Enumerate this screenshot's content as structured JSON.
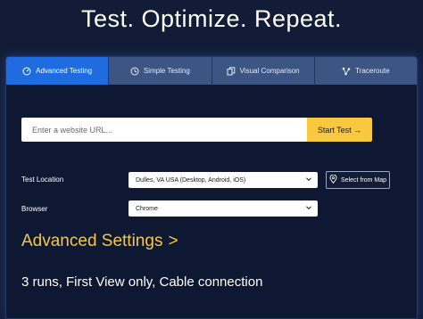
{
  "hero": {
    "title": "Test. Optimize. Repeat."
  },
  "tabs": [
    {
      "label": "Advanced Testing",
      "icon": "gauge-icon",
      "active": true
    },
    {
      "label": "Simple Testing",
      "icon": "clock-icon",
      "active": false
    },
    {
      "label": "Visual Comparison",
      "icon": "copy-icon",
      "active": false
    },
    {
      "label": "Traceroute",
      "icon": "route-icon",
      "active": false
    }
  ],
  "url_input": {
    "placeholder": "Enter a website URL...",
    "value": ""
  },
  "start_button": {
    "label": "Start Test →"
  },
  "test_location": {
    "label": "Test Location",
    "selected": "Dulles, VA USA (Desktop, Android, iOS)"
  },
  "map_button": {
    "label": "Select from Map",
    "icon": "map-pin-icon"
  },
  "browser": {
    "label": "Browser",
    "selected": "Chrome"
  },
  "advanced_settings": {
    "label": "Advanced Settings",
    "arrow": ">"
  },
  "summary": {
    "text": "3 runs, First View only, Cable connection"
  },
  "colors": {
    "background": "#121c37",
    "tab_active": "#1f6be0",
    "tab_inactive": "#3d5582",
    "accent_yellow": "#f8c93e",
    "advanced_text": "#f5c842"
  }
}
